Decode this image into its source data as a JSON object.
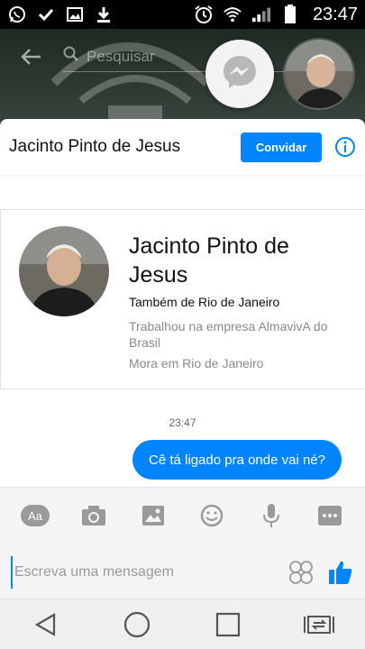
{
  "status_bar": {
    "time": "23:47",
    "left_icons": [
      "whatsapp-icon",
      "check-icon",
      "image-icon",
      "download-icon"
    ],
    "right_icons": [
      "alarm-icon",
      "wifi-icon",
      "signal-icon",
      "battery-icon"
    ]
  },
  "header": {
    "search_placeholder": "Pesquisar"
  },
  "chat": {
    "contact_name": "Jacinto Pinto de Jesus",
    "invite_label": "Convidar"
  },
  "profile_card": {
    "name": "Jacinto Pinto de Jesus",
    "line1": "Também de Rio de Janeiro",
    "line2": "Trabalhou na empresa AlmavivA do Brasil",
    "line3": "Mora em Rio de Janeiro"
  },
  "messages": [
    {
      "time": "23:47",
      "text": "Cê tá ligado pra onde vai né?"
    }
  ],
  "composer": {
    "placeholder": "Escreva uma mensagem",
    "tools": [
      "aa-icon",
      "camera-icon",
      "gallery-icon",
      "emoji-icon",
      "microphone-icon",
      "more-icon"
    ]
  },
  "colors": {
    "accent": "#0084ff",
    "status_bar": "#000000",
    "header_bg": "#2f3a31"
  }
}
